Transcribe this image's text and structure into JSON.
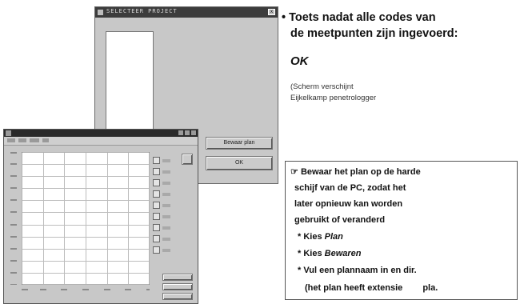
{
  "dialog": {
    "title": "SELECTEER PROJECT",
    "close_glyph": "x",
    "button_primary_label": "Bewaar plan",
    "button_secondary_label": "OK"
  },
  "instructions": {
    "bullet": "•",
    "heading_line1": "Toets nadat alle codes van",
    "heading_line2": "de meetpunten zijn ingevoerd:",
    "ok": "OK",
    "note_line1": "(Scherm verschijnt",
    "note_line2": "Eijkelkamp penetrologger"
  },
  "save_box": {
    "marker": "☞",
    "line1": "Bewaar het plan op de harde",
    "line2": "schijf van de PC, zodat het",
    "line3": "later opnieuw kan worden",
    "line4": "gebruikt of veranderd",
    "step_prefix": "* Kies",
    "step1_word": "Plan",
    "step2_word": "Bewaren",
    "line7": "* Vul een plannaam in en dir.",
    "line8_a": "(het plan heeft extensie",
    "line8_b": "pla."
  },
  "plot": {
    "grid_columns": 6,
    "grid_rows": 11
  },
  "colors": {
    "window_face": "#c8c8c8",
    "titlebar": "#3c3c3c",
    "grid_line": "#bdbdbd"
  }
}
